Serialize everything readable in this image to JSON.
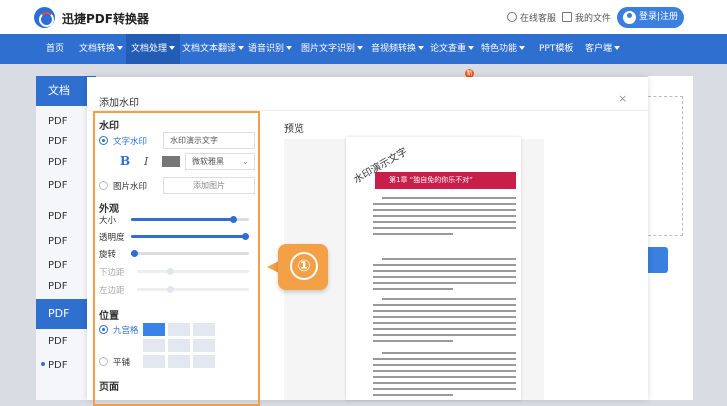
{
  "header": {
    "app_title": "迅捷PDF转换器",
    "online_service": "在线客服",
    "my_files": "我的文件",
    "login": "登录|注册"
  },
  "nav": {
    "items": [
      {
        "label": "首页",
        "dropdown": false,
        "active": false
      },
      {
        "label": "文档转换",
        "dropdown": true,
        "active": false
      },
      {
        "label": "文档处理",
        "dropdown": true,
        "active": true
      },
      {
        "label": "文档文本翻译",
        "dropdown": true,
        "active": false
      },
      {
        "label": "语音识别",
        "dropdown": true,
        "active": false
      },
      {
        "label": "图片文字识别",
        "dropdown": true,
        "active": false
      },
      {
        "label": "音视频转换",
        "dropdown": true,
        "active": false
      },
      {
        "label": "论文查重",
        "dropdown": true,
        "active": false,
        "badge": "新"
      },
      {
        "label": "特色功能",
        "dropdown": true,
        "active": false
      },
      {
        "label": "PPT模板",
        "dropdown": false,
        "active": false
      },
      {
        "label": "客户端",
        "dropdown": true,
        "active": false
      }
    ]
  },
  "background_sidebar": {
    "head1": "文档",
    "rows": [
      "PDF",
      "PDF",
      "PDF",
      "PDF",
      "PDF",
      "PDF",
      "PDF",
      "PDF"
    ],
    "head2": "PDF",
    "rows2": [
      "PDF",
      "PDF"
    ]
  },
  "modal": {
    "title": "添加水印",
    "close": "×",
    "watermark_section": "水印",
    "text_watermark_label": "文字水印",
    "text_watermark_value": "水印演示文字",
    "bold": "B",
    "italic": "I",
    "font_value": "微软雅黑",
    "image_watermark_label": "图片水印",
    "add_image_button": "添加图片",
    "appearance_section": "外观",
    "size_label": "大小",
    "opacity_label": "透明度",
    "rotate_label": "旋转",
    "bottom_margin_label": "下边距",
    "left_margin_label": "左边距",
    "size_level": 0.87,
    "opacity_level": 1.0,
    "rotate_level": 0.03,
    "bottom_margin_level": 0.3,
    "left_margin_level": 0.3,
    "position_section": "位置",
    "grid_label": "九宫格",
    "tile_label": "平铺",
    "page_section": "页面",
    "preview_label": "预览",
    "step_badge": "①",
    "colors": {
      "accent": "#2f6fd0",
      "highlight": "#f0a04b",
      "chapter": "#c81e4a"
    }
  },
  "preview": {
    "chapter_title": "第1章  “独自免的你乐不对”",
    "watermark_text": "水印演示文字"
  }
}
